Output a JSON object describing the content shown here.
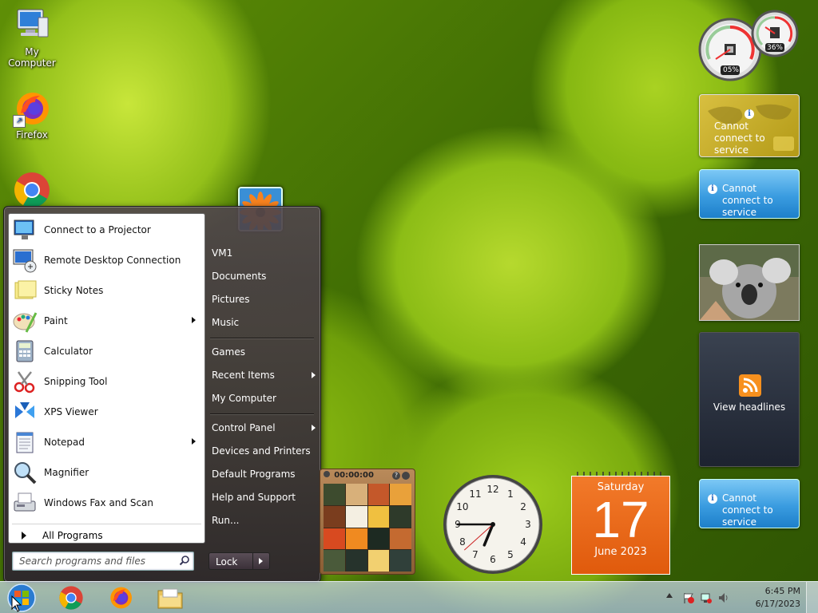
{
  "desktop": {
    "icons": [
      {
        "label": "My Computer",
        "icon": "computer-icon"
      },
      {
        "label": "Firefox",
        "icon": "firefox-icon"
      },
      {
        "label": "",
        "icon": "chrome-icon"
      }
    ]
  },
  "start_menu": {
    "programs": [
      {
        "label": "Connect to a Projector",
        "icon": "projector-icon",
        "has_submenu": false
      },
      {
        "label": "Remote Desktop Connection",
        "icon": "remote-desktop-icon",
        "has_submenu": false
      },
      {
        "label": "Sticky Notes",
        "icon": "sticky-notes-icon",
        "has_submenu": false
      },
      {
        "label": "Paint",
        "icon": "paint-icon",
        "has_submenu": true
      },
      {
        "label": "Calculator",
        "icon": "calculator-icon",
        "has_submenu": false
      },
      {
        "label": "Snipping Tool",
        "icon": "scissors-icon",
        "has_submenu": false
      },
      {
        "label": "XPS Viewer",
        "icon": "xps-viewer-icon",
        "has_submenu": false
      },
      {
        "label": "Notepad",
        "icon": "notepad-icon",
        "has_submenu": true
      },
      {
        "label": "Magnifier",
        "icon": "magnifier-icon",
        "has_submenu": false
      },
      {
        "label": "Windows Fax and Scan",
        "icon": "fax-icon",
        "has_submenu": false
      }
    ],
    "all_programs": "All Programs",
    "search_placeholder": "Search programs and files",
    "right_items": [
      {
        "label": "VM1",
        "has_submenu": false
      },
      {
        "label": "Documents",
        "has_submenu": false
      },
      {
        "label": "Pictures",
        "has_submenu": false
      },
      {
        "label": "Music",
        "has_submenu": false
      },
      {
        "label": "Games",
        "has_submenu": false
      },
      {
        "label": "Recent Items",
        "has_submenu": true
      },
      {
        "label": "My Computer",
        "has_submenu": false
      },
      {
        "label": "Control Panel",
        "has_submenu": true
      },
      {
        "label": "Devices and Printers",
        "has_submenu": false
      },
      {
        "label": "Default Programs",
        "has_submenu": false
      },
      {
        "label": "Help and Support",
        "has_submenu": false
      },
      {
        "label": "Run...",
        "has_submenu": false
      }
    ],
    "lock_label": "Lock"
  },
  "gadgets": {
    "cpu_meter": {
      "cpu": "05%",
      "memory": "36%",
      "cpu_value": 5,
      "memory_value": 36
    },
    "weather": {
      "status": "Cannot connect to service"
    },
    "currency": {
      "status": "Cannot connect to service"
    },
    "feed": {
      "label": "View headlines"
    },
    "stocks": {
      "status": "Cannot connect to service"
    },
    "calendar": {
      "weekday": "Saturday",
      "day": "17",
      "month_year": "June 2023"
    },
    "clock": {
      "hour": 6,
      "minute": 45,
      "second": 38
    },
    "puzzle": {
      "timer": "00:00:00"
    }
  },
  "taskbar": {
    "apps": [
      "start-orb-icon",
      "chrome-icon",
      "firefox-icon",
      "folder-icon"
    ],
    "time": "6:45 PM",
    "date": "6/17/2023"
  },
  "colors": {
    "calendar": "#e8661a",
    "gadget_blue": "#3a9ce0",
    "weather": "#c8ae2a"
  }
}
